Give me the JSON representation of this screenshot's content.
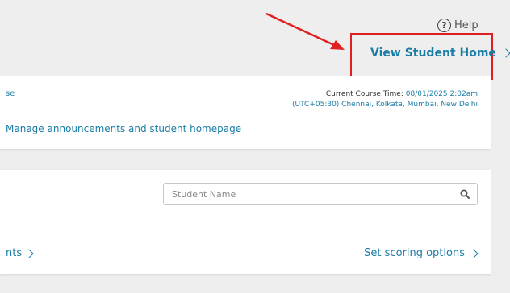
{
  "header": {
    "help_label": "Help",
    "view_student_home_label": "View Student Home"
  },
  "annotation": {
    "color": "#e02020"
  },
  "course_card": {
    "course_link_partial": "se",
    "current_course_time_label": "Current Course Time:",
    "current_course_time_value": "08/01/2025 2:02am",
    "timezone": "(UTC+05:30) Chennai, Kolkata, Mumbai, New Delhi",
    "manage_link": "Manage announcements and student homepage"
  },
  "gradebook_card": {
    "search": {
      "placeholder": "Student Name",
      "value": ""
    },
    "left_link_partial": "nts",
    "scoring_link": "Set scoring options"
  },
  "colors": {
    "link": "#1a7da6",
    "background": "#eeeeee",
    "card": "#ffffff"
  }
}
